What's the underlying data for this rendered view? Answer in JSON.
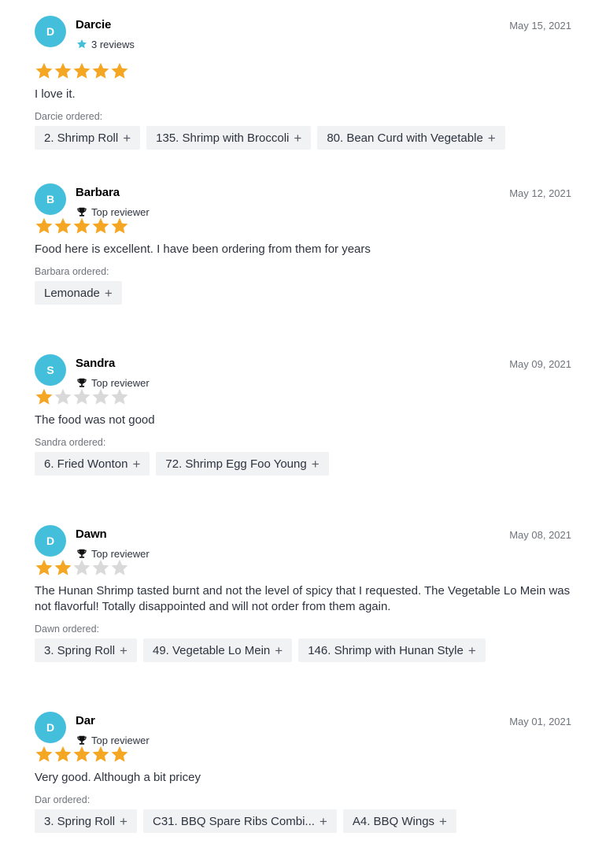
{
  "reviews": [
    {
      "initial": "D",
      "name": "Darcie",
      "badge_icon": "star-icon",
      "badge_text": "3 reviews",
      "date": "May 15, 2021",
      "rating": 5,
      "text": "I love it.",
      "ordered_label": "Darcie ordered:",
      "items": [
        "2. Shrimp Roll",
        "135. Shrimp with Broccoli",
        "80. Bean Curd with Vegetable"
      ]
    },
    {
      "initial": "B",
      "name": "Barbara",
      "badge_icon": "trophy-icon",
      "badge_text": "Top reviewer",
      "date": "May 12, 2021",
      "rating": 5,
      "text": "Food here is excellent. I have been ordering from them for years",
      "ordered_label": "Barbara ordered:",
      "items": [
        "Lemonade"
      ]
    },
    {
      "initial": "S",
      "name": "Sandra",
      "badge_icon": "trophy-icon",
      "badge_text": "Top reviewer",
      "date": "May 09, 2021",
      "rating": 1,
      "text": "The food was not good",
      "ordered_label": "Sandra ordered:",
      "items": [
        "6. Fried Wonton",
        "72. Shrimp Egg Foo Young"
      ]
    },
    {
      "initial": "D",
      "name": "Dawn",
      "badge_icon": "trophy-icon",
      "badge_text": "Top reviewer",
      "date": "May 08, 2021",
      "rating": 2,
      "text": "The Hunan Shrimp tasted burnt and not the level of spicy that I requested. The Vegetable Lo Mein was not flavorful! Totally disappointed and will not order from them again.",
      "ordered_label": "Dawn ordered:",
      "items": [
        "3. Spring Roll",
        "49. Vegetable Lo Mein",
        "146. Shrimp with Hunan Style"
      ]
    },
    {
      "initial": "D",
      "name": "Dar",
      "badge_icon": "trophy-icon",
      "badge_text": "Top reviewer",
      "date": "May 01, 2021",
      "rating": 5,
      "text": "Very good. Although a bit pricey",
      "ordered_label": "Dar ordered:",
      "items": [
        "3. Spring Roll",
        "C31. BBQ Spare Ribs Combi...",
        "A4. BBQ Wings"
      ]
    }
  ],
  "colors": {
    "avatar": "#44bfdb",
    "star_filled": "#f5a623",
    "star_empty": "#d9d9d9",
    "badge_star": "#44bfdb"
  },
  "chip_add_symbol": "+"
}
